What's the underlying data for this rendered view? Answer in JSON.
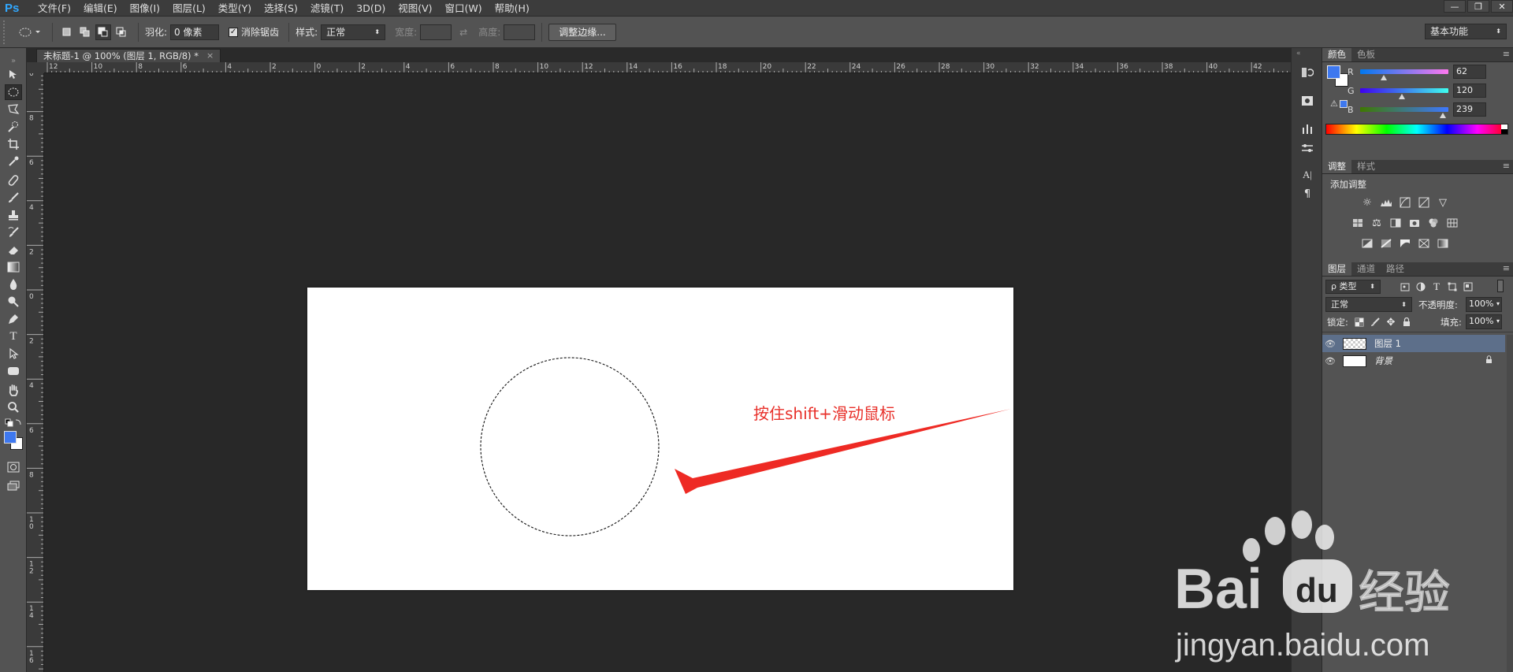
{
  "app": {
    "logo": "Ps"
  },
  "menu": [
    "文件(F)",
    "编辑(E)",
    "图像(I)",
    "图层(L)",
    "类型(Y)",
    "选择(S)",
    "滤镜(T)",
    "3D(D)",
    "视图(V)",
    "窗口(W)",
    "帮助(H)"
  ],
  "window_controls": [
    "—",
    "❐",
    "✕"
  ],
  "options": {
    "feather_label": "羽化:",
    "feather_value": "0 像素",
    "antialias_label": "消除锯齿",
    "antialias_checked": true,
    "style_label": "样式:",
    "style_value": "正常",
    "width_label": "宽度:",
    "height_label": "高度:",
    "refine_button": "调整边缘...",
    "workspace": "基本功能"
  },
  "document": {
    "tab_title": "未标题-1 @ 100% (图层 1, RGB/8) *",
    "annotation_text": "按住shift+滑动鼠标",
    "annotation_color": "#e8302a"
  },
  "ruler": {
    "top_labels": [
      "12",
      "10",
      "8",
      "6",
      "4",
      "2",
      "0",
      "2",
      "4",
      "6",
      "8",
      "10",
      "12",
      "14",
      "16",
      "18",
      "20",
      "22",
      "24",
      "26",
      "28",
      "30",
      "32",
      "34",
      "36",
      "38",
      "40",
      "42"
    ],
    "left_labels": [
      "0",
      "8",
      "6",
      "4",
      "2",
      "0",
      "2",
      "4",
      "6",
      "8",
      "10",
      "12",
      "14",
      "16"
    ]
  },
  "panels": {
    "color": {
      "tabs": [
        "颜色",
        "色板"
      ],
      "foreground": "#3e78ef",
      "background": "#ffffff",
      "r_label": "R",
      "r_value": "62",
      "g_label": "G",
      "g_value": "120",
      "b_label": "B",
      "b_value": "239"
    },
    "adjustments": {
      "tabs": [
        "调整",
        "样式"
      ],
      "heading": "添加调整",
      "icons": [
        "brightness-icon",
        "levels-icon",
        "curves-icon",
        "exposure-icon",
        "vibrance-icon",
        "hue-saturation-icon",
        "color-balance-icon",
        "black-white-icon",
        "photo-filter-icon",
        "channel-mixer-icon",
        "color-lookup-icon",
        "invert-icon",
        "posterize-icon",
        "threshold-icon",
        "selective-color-icon",
        "gradient-map-icon"
      ]
    },
    "layers": {
      "tabs": [
        "图层",
        "通道",
        "路径"
      ],
      "filter_label": "ρ 类型",
      "blend_mode": "正常",
      "opacity_label": "不透明度:",
      "opacity_value": "100%",
      "lock_label": "锁定:",
      "fill_label": "填充:",
      "fill_value": "100%",
      "items": [
        {
          "name": "图层 1",
          "selected": true
        },
        {
          "name": "背景",
          "selected": false
        }
      ]
    }
  },
  "watermark": {
    "brand": "Bai",
    "brand2": "经验",
    "url": "jingyan.baidu.com"
  }
}
